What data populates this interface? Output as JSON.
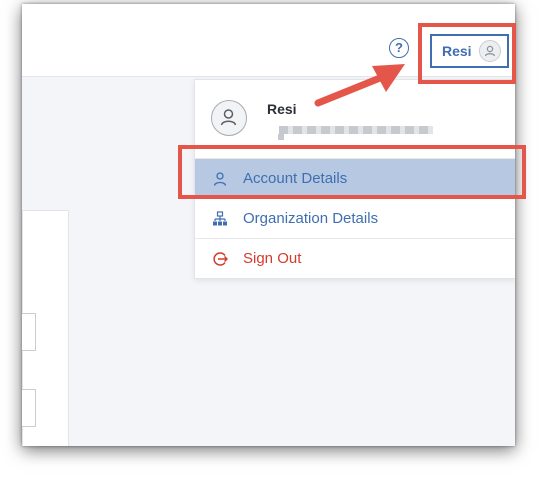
{
  "header": {
    "help_label": "?",
    "user_button_label": "Resi"
  },
  "menu": {
    "user_name": "Resi",
    "user_email": "redacted",
    "items": [
      {
        "label": "Account Details",
        "icon": "user-icon"
      },
      {
        "label": "Organization Details",
        "icon": "org-chart-icon"
      },
      {
        "label": "Sign Out",
        "icon": "sign-out-icon"
      }
    ]
  },
  "colors": {
    "accent": "#3f6fb0",
    "danger": "#d33b2c",
    "highlight": "#b6c8e2",
    "annotation": "#e4564a"
  }
}
